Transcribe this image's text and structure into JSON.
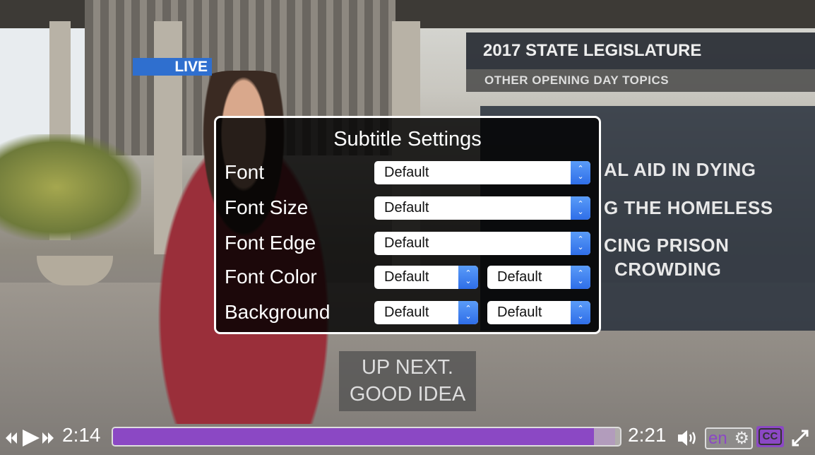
{
  "video": {
    "live_label": "LIVE",
    "graphic_title": "2017 STATE LEGISLATURE",
    "graphic_subtitle": "OTHER OPENING DAY TOPICS",
    "headlines": [
      "AL AID IN DYING",
      "G THE HOMELESS",
      "CING PRISON",
      "CROWDING"
    ],
    "caption_lines": [
      "UP NEXT.",
      "GOOD IDEA"
    ]
  },
  "dialog": {
    "title": "Subtitle Settings",
    "rows": [
      {
        "label": "Font",
        "values": [
          "Default"
        ]
      },
      {
        "label": "Font Size",
        "values": [
          "Default"
        ]
      },
      {
        "label": "Font Edge",
        "values": [
          "Default"
        ]
      },
      {
        "label": "Font Color",
        "values": [
          "Default",
          "Default"
        ]
      },
      {
        "label": "Background",
        "values": [
          "Default",
          "Default"
        ]
      }
    ]
  },
  "controls": {
    "current_time": "2:14",
    "duration": "2:21",
    "progress_percent": 94.8,
    "buffered_percent": 99,
    "language": "en",
    "cc_label": "CC",
    "accent_color": "#8b48c4",
    "icons": [
      "rewind-icon",
      "play-icon",
      "fast-forward-icon",
      "volume-icon",
      "gear-icon",
      "closed-captions-icon",
      "fullscreen-icon"
    ]
  }
}
